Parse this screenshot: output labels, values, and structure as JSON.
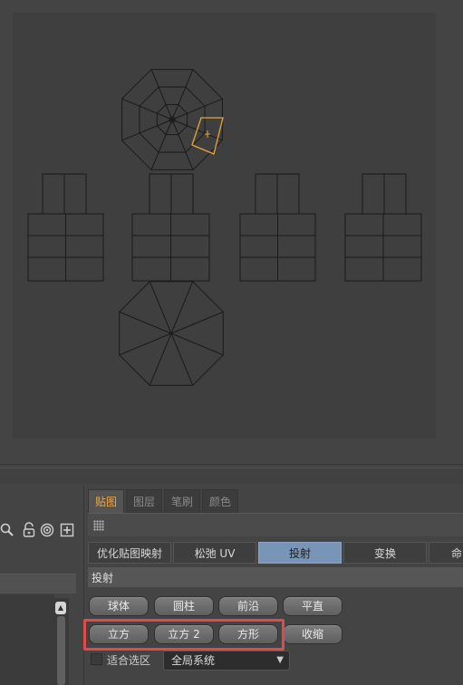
{
  "tabs": [
    {
      "label": "贴图",
      "active": true
    },
    {
      "label": "图层",
      "active": false
    },
    {
      "label": "笔刷",
      "active": false
    },
    {
      "label": "颜色",
      "active": false
    }
  ],
  "subtabs": [
    {
      "label": "优化贴图映射",
      "active": false
    },
    {
      "label": "松弛 UV",
      "active": false
    },
    {
      "label": "投射",
      "active": true
    },
    {
      "label": "变换",
      "active": false
    },
    {
      "label": "命",
      "active": false
    }
  ],
  "section": {
    "title": "投射"
  },
  "buttons": {
    "sphere": "球体",
    "cylinder": "圆柱",
    "front": "前沿",
    "planar": "平直",
    "cube": "立方",
    "cube2": "立方 2",
    "square": "方形",
    "shrink": "收缩"
  },
  "fit": {
    "label": "适合选区",
    "checked": false
  },
  "coord_select": {
    "value": "全局系统"
  },
  "left_toolbar": {
    "icons": [
      "search-icon",
      "lock-icon",
      "target-icon",
      "add-icon"
    ]
  },
  "colors": {
    "accent_tab": "#f2a640",
    "active_subtab": "#7894b6",
    "selected_face": "#e8a63a",
    "highlight_box": "#e24a4a"
  }
}
